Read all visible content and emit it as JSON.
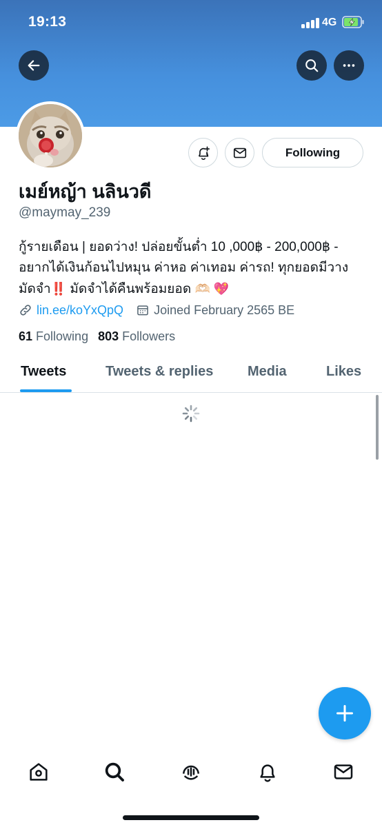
{
  "status_bar": {
    "time": "19:13",
    "network": "4G"
  },
  "header": {
    "back_icon": "arrow-left-icon",
    "search_icon": "search-icon",
    "more_icon": "more-horizontal-icon",
    "banner_color": "#4690dd"
  },
  "profile": {
    "display_name": "เมย์หญ้า นลินวดี",
    "handle": "@maymay_239",
    "bio_text": "กู้รายเดือน | ยอดว่าง! ปล่อยขั้นต่ำ 10 ,000฿ - 200,000฿ - อยากได้เงินก้อนไปหมุน ค่าหอ ค่าเทอม ค่ารถ! ทุกยอดมีวางมัดจำ",
    "bio_emoji_1": "‼️",
    "bio_text_2": " มัดจำได้คืนพร้อมยอด ",
    "bio_emoji_2": "🫶🏻 💖",
    "link": "lin.ee/koYxQpQ",
    "joined": "Joined February 2565 BE",
    "following_count": "61",
    "following_label": "Following",
    "followers_count": "803",
    "followers_label": "Followers"
  },
  "actions": {
    "following_button": "Following",
    "notify_icon": "bell-plus-icon",
    "message_icon": "mail-icon"
  },
  "tabs": [
    {
      "label": "Tweets",
      "active": true
    },
    {
      "label": "Tweets & replies",
      "active": false
    },
    {
      "label": "Media",
      "active": false
    },
    {
      "label": "Likes",
      "active": false
    }
  ],
  "fab": {
    "icon": "plus-icon",
    "color": "#1d9bf0"
  },
  "bottom_nav": [
    "home-icon",
    "search-icon",
    "spaces-icon",
    "notifications-icon",
    "messages-icon"
  ],
  "accent": "#1d9bf0"
}
